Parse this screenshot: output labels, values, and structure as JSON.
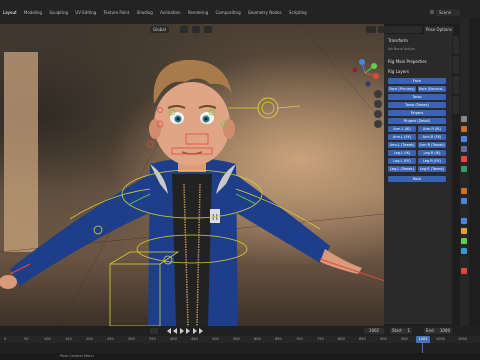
{
  "topbar": {
    "tabs": [
      "Layout",
      "Modeling",
      "Sculpting",
      "UV Editing",
      "Texture Paint",
      "Shading",
      "Animation",
      "Rendering",
      "Compositing",
      "Geometry Nodes",
      "Scripting"
    ],
    "active_tab": "Layout",
    "scene": "Scene"
  },
  "viewport": {
    "orientation_label": "Global",
    "pose_options_label": "Pose Options",
    "axes": {
      "x": "X",
      "y": "Y",
      "z": "Z"
    }
  },
  "npanel": {
    "transform_label": "Transform",
    "no_bone_label": "No Bone Active",
    "rig_main_props_label": "Rig Main Properties",
    "rig_layers_label": "Rig Layers",
    "layer_buttons": [
      [
        "Face"
      ],
      [
        "Face (Primary)",
        "Face (Second..."
      ],
      [
        "Torso"
      ],
      [
        "Torso (Tweak)"
      ],
      [
        "Fingers"
      ],
      [
        "Fingers (Detail)"
      ],
      [
        "Arm.L (IK)",
        "Arm.R (IK)"
      ],
      [
        "Arm.L (FK)",
        "Arm.R (FK)"
      ],
      [
        "Arm.L (Tweak)",
        "Arm.R (Tweak)"
      ],
      [
        "Leg.L (IK)",
        "Leg.R (IK)"
      ],
      [
        "Leg.L (FK)",
        "Leg.R (FK)"
      ],
      [
        "Leg.L (Tweak)",
        "Leg.R (Tweak)"
      ],
      [
        "Root"
      ]
    ],
    "side_tabs": [
      "Item",
      "Tool",
      "View",
      "Animation",
      "ARP"
    ]
  },
  "timeline": {
    "current_frame": "1002",
    "start_label": "Start",
    "start_value": "1",
    "end_label": "End",
    "end_value": "1000",
    "ruler_ticks": [
      "0",
      "50",
      "100",
      "150",
      "200",
      "250",
      "300",
      "350",
      "400",
      "450",
      "500",
      "550",
      "600",
      "650",
      "700",
      "750",
      "800",
      "850",
      "900",
      "950",
      "1000",
      "1050"
    ],
    "status": "Pose Context Menu"
  },
  "colors": {
    "accent": "#4772b3",
    "rig_layer_button": "#3a64b2",
    "rig_wire": "#d7d13a",
    "bone_red": "#e04a3a",
    "bone_green": "#5fd14a",
    "jacket": "#1f3e8a"
  }
}
